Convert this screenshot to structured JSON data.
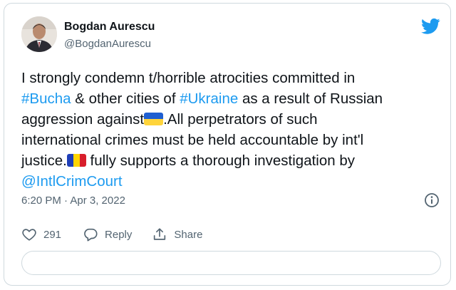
{
  "author": {
    "name": "Bogdan Aurescu",
    "handle": "@BogdanAurescu"
  },
  "tweet": {
    "line1": "I strongly condemn t/horrible atrocities committed in",
    "line2": {
      "hashtag1": "#Bucha",
      "middle": " & other cities of ",
      "hashtag2": "#Ukraine",
      "tail": " as a result of Russian"
    },
    "line3": {
      "before_flag": "aggression against",
      "after_flag": ".All perpetrators of such"
    },
    "line4": "international crimes must be held accountable by int'l",
    "line5": {
      "before_flag": "justice.",
      "after_flag": " fully supports a thorough investigation by"
    },
    "line6": "@IntlCrimCourt"
  },
  "meta": {
    "timestamp": "6:20 PM · Apr 3, 2022"
  },
  "actions": {
    "likes": "291",
    "reply_label": "Reply",
    "share_label": "Share"
  },
  "colors": {
    "link": "#1d9bf0",
    "text": "#0f1419",
    "secondary": "#536471",
    "border": "#cfd9de",
    "ukraine_flag": [
      "#1f5fd1",
      "#ffd43b"
    ],
    "romania_flag": [
      "#1f3fb8",
      "#ffd500",
      "#d81e2b"
    ]
  },
  "icons": {
    "brand": "twitter-bird-icon",
    "info": "info-icon",
    "like": "heart-icon",
    "reply": "speech-bubble-icon",
    "share": "share-upload-icon"
  }
}
